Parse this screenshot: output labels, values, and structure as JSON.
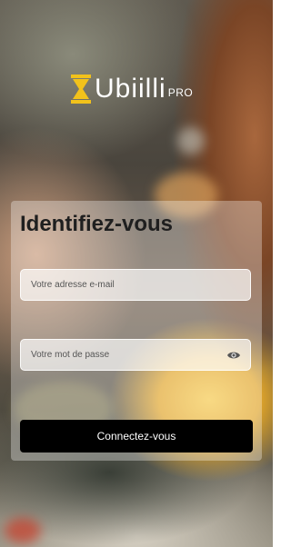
{
  "brand": {
    "name": "Ubiilli",
    "suffix": "PRO",
    "accent_color": "#f2c21b",
    "icon": "hourglass-icon"
  },
  "login": {
    "title": "Identifiez-vous",
    "email_placeholder": "Votre adresse e-mail",
    "email_value": "",
    "password_placeholder": "Votre mot de passe",
    "password_value": "",
    "password_toggle_icon": "eye-icon",
    "submit_label": "Connectez-vous"
  }
}
